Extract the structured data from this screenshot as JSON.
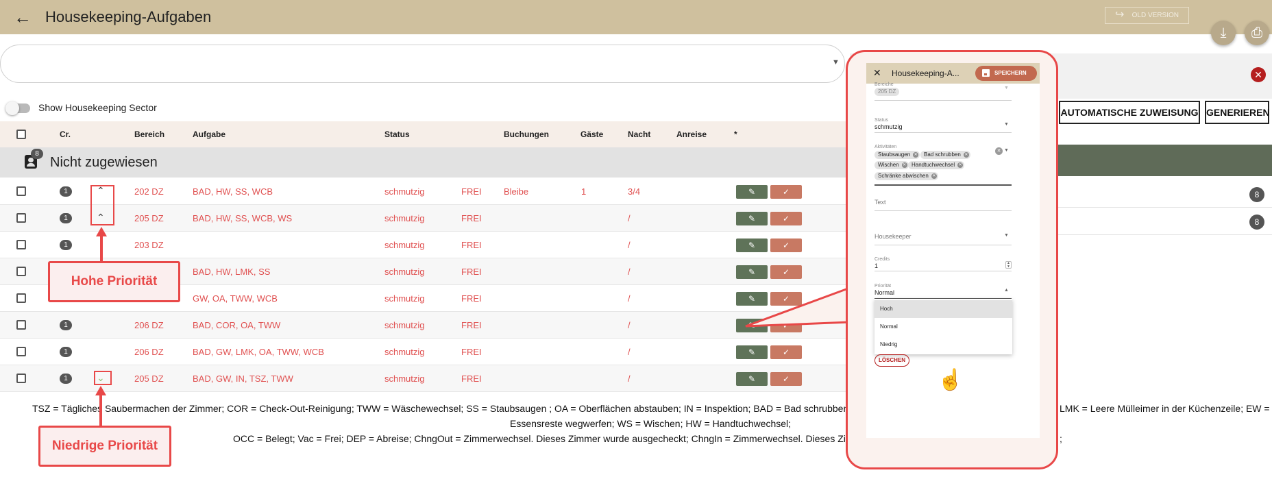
{
  "header": {
    "title": "Housekeeping-Aufgaben",
    "old_version": "OLD VERSION"
  },
  "toggle": {
    "label": "Show Housekeeping Sector"
  },
  "table": {
    "columns": [
      "Cr.",
      "Bereich",
      "Aufgabe",
      "Status",
      "Buchungen",
      "Gäste",
      "Nacht",
      "Anreise",
      "*"
    ],
    "group": {
      "title": "Nicht zugewiesen",
      "count": "8"
    },
    "rows": [
      {
        "credit": "1",
        "prio": "high",
        "room": "202 DZ",
        "task": "BAD, HW, SS, WCB",
        "status": "schmutzig",
        "occ": "FREI",
        "booking": "Bleibe",
        "guests": "1",
        "night": "3/4"
      },
      {
        "credit": "1",
        "prio": "high",
        "room": "205 DZ",
        "task": "BAD, HW, SS, WCB, WS",
        "status": "schmutzig",
        "occ": "FREI",
        "booking": "",
        "guests": "",
        "night": "/"
      },
      {
        "credit": "1",
        "prio": "",
        "room": "203 DZ",
        "task": "",
        "status": "schmutzig",
        "occ": "FREI",
        "booking": "",
        "guests": "",
        "night": "/"
      },
      {
        "credit": "",
        "prio": "",
        "room": "",
        "task": "BAD, HW, LMK, SS",
        "status": "schmutzig",
        "occ": "FREI",
        "booking": "",
        "guests": "",
        "night": "/"
      },
      {
        "credit": "",
        "prio": "",
        "room": "",
        "task": "GW, OA, TWW, WCB",
        "status": "schmutzig",
        "occ": "FREI",
        "booking": "",
        "guests": "",
        "night": "/"
      },
      {
        "credit": "1",
        "prio": "",
        "room": "206 DZ",
        "task": "BAD, COR, OA, TWW",
        "status": "schmutzig",
        "occ": "FREI",
        "booking": "",
        "guests": "",
        "night": "/"
      },
      {
        "credit": "1",
        "prio": "",
        "room": "206 DZ",
        "task": "BAD, GW, LMK, OA, TWW, WCB",
        "status": "schmutzig",
        "occ": "FREI",
        "booking": "",
        "guests": "",
        "night": "/"
      },
      {
        "credit": "1",
        "prio": "low",
        "room": "205 DZ",
        "task": "BAD, GW, IN, TSZ, TWW",
        "status": "schmutzig",
        "occ": "FREI",
        "booking": "",
        "guests": "",
        "night": "/"
      }
    ],
    "icons": {
      "edit": "✎",
      "done": "✓",
      "prio_high": "⌃",
      "prio_low": "⌄"
    }
  },
  "right": {
    "auto_assign": "AUTOMATISCHE ZUWEISUNG",
    "generate": "GENERIEREN",
    "row_badges": [
      "8",
      "8"
    ]
  },
  "legend": {
    "line1_a": "TSZ = Tägliches Saubermachen der Zimmer; COR = Check-Out-Reinigung; TWW = Wäschewechsel; SS = Staubsaugen ; OA = Oberflächen abstauben; IN = Inspektion; BAD = Bad schrubben ; GW",
    "line1_b": "LMK = Leere Mülleimer in der Küchenzeile; EW =",
    "line2": "Essensreste wegwerfen; WS = Wischen; HW = Handtuchwechsel;",
    "line3_a": "OCC = Belegt; Vac = Frei; DEP = Abreise; ChngOut = Zimmerwechsel. Dieses Zimmer wurde ausgecheckt; ChngIn = Zimmerwechsel. Dieses Zimm",
    "line3_b": ";"
  },
  "callouts": {
    "high": "Hohe Priorität",
    "low": "Niedrige Priorität"
  },
  "dialog": {
    "title": "Housekeeping-A...",
    "save": "SPEICHERN",
    "bereiche_label": "Bereiche",
    "bereiche_value": "205 DZ",
    "status_label": "Status",
    "status_value": "schmutzig",
    "activities_label": "Aktivitäten",
    "chips": [
      "Staubsaugen",
      "Bad schrubben",
      "Wischen",
      "Handtuchwechsel",
      "Schränke abwischen"
    ],
    "text_label": "Text",
    "housekeeper_label": "Housekeeper",
    "credits_label": "Credits",
    "credits_value": "1",
    "priority_label": "Priorität",
    "priority_value": "Normal",
    "options": [
      "Hoch",
      "Normal",
      "Niedrig"
    ],
    "delete": "LÖSCHEN"
  },
  "colors": {
    "header_bg": "#cfc09e",
    "accent_red": "#e84848",
    "edit_green": "#5f7359",
    "done_brown": "#c87963",
    "status_text": "#e05050"
  }
}
